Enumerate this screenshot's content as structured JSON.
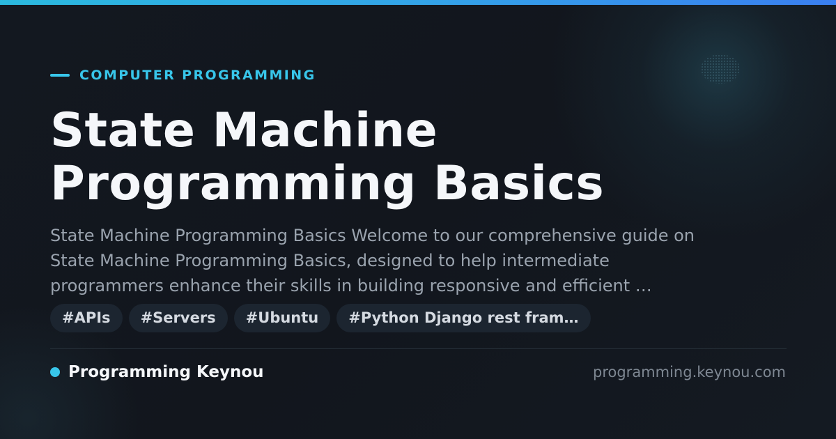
{
  "header": {
    "category": "COMPUTER PROGRAMMING",
    "title_line1": "State Machine",
    "title_line2": "Programming Basics"
  },
  "description": {
    "line1": "State Machine Programming Basics Welcome to our comprehensive guide on",
    "line2": "State Machine Programming Basics, designed to help intermediate",
    "line3": "programmers enhance their skills in building responsive and efficient …"
  },
  "tags": [
    "#APIs",
    "#Servers",
    "#Ubuntu",
    "#Python Django rest fram…"
  ],
  "footer": {
    "brand": "Programming Keynou",
    "domain": "programming.keynou.com"
  },
  "colors": {
    "accent": "#38c6ea",
    "background": "#13171f",
    "title": "#f5f7fa",
    "body_text": "#9aa3ae",
    "tag_background": "#1c2530"
  }
}
